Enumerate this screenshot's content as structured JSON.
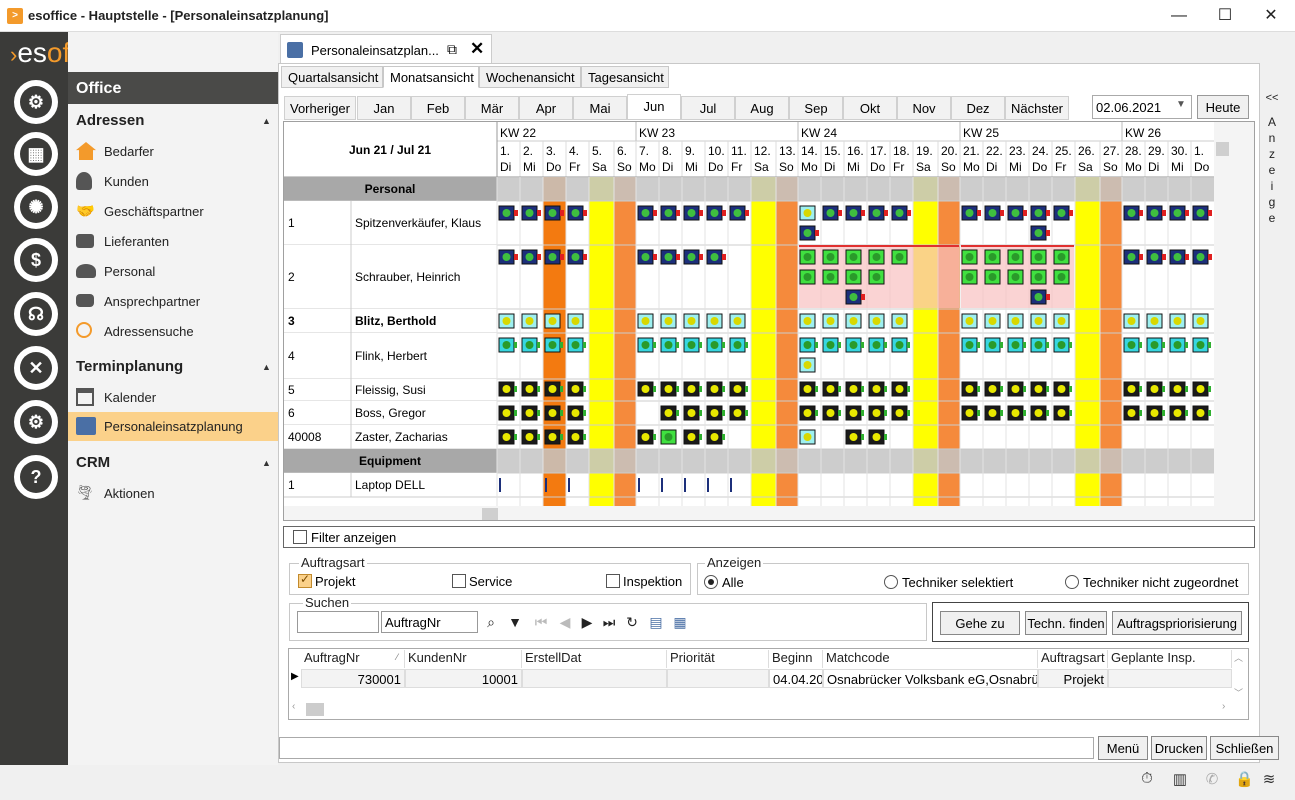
{
  "window": {
    "title": "esoffice - Hauptstelle - [Personaleinsatzplanung]",
    "minimize": "—",
    "maximize": "☐",
    "close": "✕"
  },
  "logo": {
    "part1": "es",
    "part2": "office"
  },
  "sidebar": {
    "header": "Office",
    "sections": [
      {
        "title": "Adressen",
        "items": [
          "Bedarfer",
          "Kunden",
          "Geschäftspartner",
          "Lieferanten",
          "Personal",
          "Ansprechpartner",
          "Adressensuche"
        ]
      },
      {
        "title": "Terminplanung",
        "items": [
          "Kalender",
          "Personaleinsatzplanung"
        ]
      },
      {
        "title": "CRM",
        "items": [
          "Aktionen"
        ]
      }
    ],
    "selected": "Personaleinsatzplanung"
  },
  "doc_tab": {
    "label": "Personaleinsatzplan..."
  },
  "view_tabs": [
    "Quartalsansicht",
    "Monatsansicht",
    "Wochenansicht",
    "Tagesansicht"
  ],
  "active_view": "Monatsansicht",
  "month_nav": {
    "prev": "Vorheriger",
    "months": [
      "Jan",
      "Feb",
      "Mär",
      "Apr",
      "Mai",
      "Jun",
      "Jul",
      "Aug",
      "Sep",
      "Okt",
      "Nov",
      "Dez"
    ],
    "active": "Jun",
    "next": "Nächster"
  },
  "date": {
    "value": "02.06.2021",
    "today_button": "Heute"
  },
  "right_strip": {
    "arrows": "<<",
    "letters": [
      "A",
      "n",
      "z",
      "e",
      "i",
      "g",
      "e"
    ]
  },
  "grid": {
    "period": "Jun 21 / Jul 21",
    "weeks": [
      "KW 22",
      "KW 23",
      "KW 24",
      "KW 25",
      "KW 26"
    ],
    "days": [
      {
        "d": "1.",
        "w": "Di"
      },
      {
        "d": "2.",
        "w": "Mi"
      },
      {
        "d": "3.",
        "w": "Do"
      },
      {
        "d": "4.",
        "w": "Fr"
      },
      {
        "d": "5.",
        "w": "Sa"
      },
      {
        "d": "6.",
        "w": "So"
      },
      {
        "d": "7.",
        "w": "Mo"
      },
      {
        "d": "8.",
        "w": "Di"
      },
      {
        "d": "9.",
        "w": "Mi"
      },
      {
        "d": "10.",
        "w": "Do"
      },
      {
        "d": "11.",
        "w": "Fr"
      },
      {
        "d": "12.",
        "w": "Sa"
      },
      {
        "d": "13.",
        "w": "So"
      },
      {
        "d": "14.",
        "w": "Mo"
      },
      {
        "d": "15.",
        "w": "Di"
      },
      {
        "d": "16.",
        "w": "Mi"
      },
      {
        "d": "17.",
        "w": "Do"
      },
      {
        "d": "18.",
        "w": "Fr"
      },
      {
        "d": "19.",
        "w": "Sa"
      },
      {
        "d": "20.",
        "w": "So"
      },
      {
        "d": "21.",
        "w": "Mo"
      },
      {
        "d": "22.",
        "w": "Di"
      },
      {
        "d": "23.",
        "w": "Mi"
      },
      {
        "d": "24.",
        "w": "Do"
      },
      {
        "d": "25.",
        "w": "Fr"
      },
      {
        "d": "26.",
        "w": "Sa"
      },
      {
        "d": "27.",
        "w": "So"
      },
      {
        "d": "28.",
        "w": "Mo"
      },
      {
        "d": "29.",
        "w": "Di"
      },
      {
        "d": "30.",
        "w": "Mi"
      },
      {
        "d": "1.",
        "w": "Do"
      }
    ],
    "groups": [
      {
        "name": "Personal",
        "rows": [
          {
            "id": "1",
            "name": "Spitzenverkäufer, Klaus",
            "bold": false
          },
          {
            "id": "2",
            "name": "Schrauber, Heinrich",
            "bold": false
          },
          {
            "id": "3",
            "name": "Blitz, Berthold",
            "bold": true
          },
          {
            "id": "4",
            "name": "Flink, Herbert",
            "bold": false
          },
          {
            "id": "5",
            "name": "Fleissig, Susi",
            "bold": false
          },
          {
            "id": "6",
            "name": "Boss, Gregor",
            "bold": false
          },
          {
            "id": "40008",
            "name": "Zaster, Zacharias",
            "bold": false
          }
        ]
      },
      {
        "name": "Equipment",
        "rows": [
          {
            "id": "1",
            "name": "Laptop DELL",
            "bold": false
          }
        ]
      }
    ]
  },
  "filter": {
    "label": "Filter anzeigen"
  },
  "auftragsart": {
    "title": "Auftragsart",
    "options": [
      {
        "label": "Projekt",
        "checked": true
      },
      {
        "label": "Service",
        "checked": false
      },
      {
        "label": "Inspektion",
        "checked": false
      }
    ]
  },
  "anzeigen": {
    "title": "Anzeigen",
    "options": [
      {
        "label": "Alle",
        "selected": true
      },
      {
        "label": "Techniker selektiert",
        "selected": false
      },
      {
        "label": "Techniker nicht zugeordnet",
        "selected": false
      }
    ]
  },
  "suchen": {
    "title": "Suchen",
    "value": "",
    "field": "AuftragNr"
  },
  "actions": {
    "goto": "Gehe zu",
    "find_tech": "Techn. finden",
    "priority": "Auftragspriorisierung"
  },
  "results": {
    "columns": [
      "AuftragNr",
      "KundenNr",
      "ErstellDat",
      "Priorität",
      "Beginn",
      "Matchcode",
      "Auftragsart",
      "Geplante Insp."
    ],
    "rows": [
      [
        "730001",
        "10001",
        "",
        "",
        "04.04.20",
        "Osnabrücker Volksbank eG,Osnabrüc",
        "Projekt",
        ""
      ]
    ]
  },
  "footer_buttons": [
    "Menü",
    "Drucken",
    "Schließen"
  ]
}
